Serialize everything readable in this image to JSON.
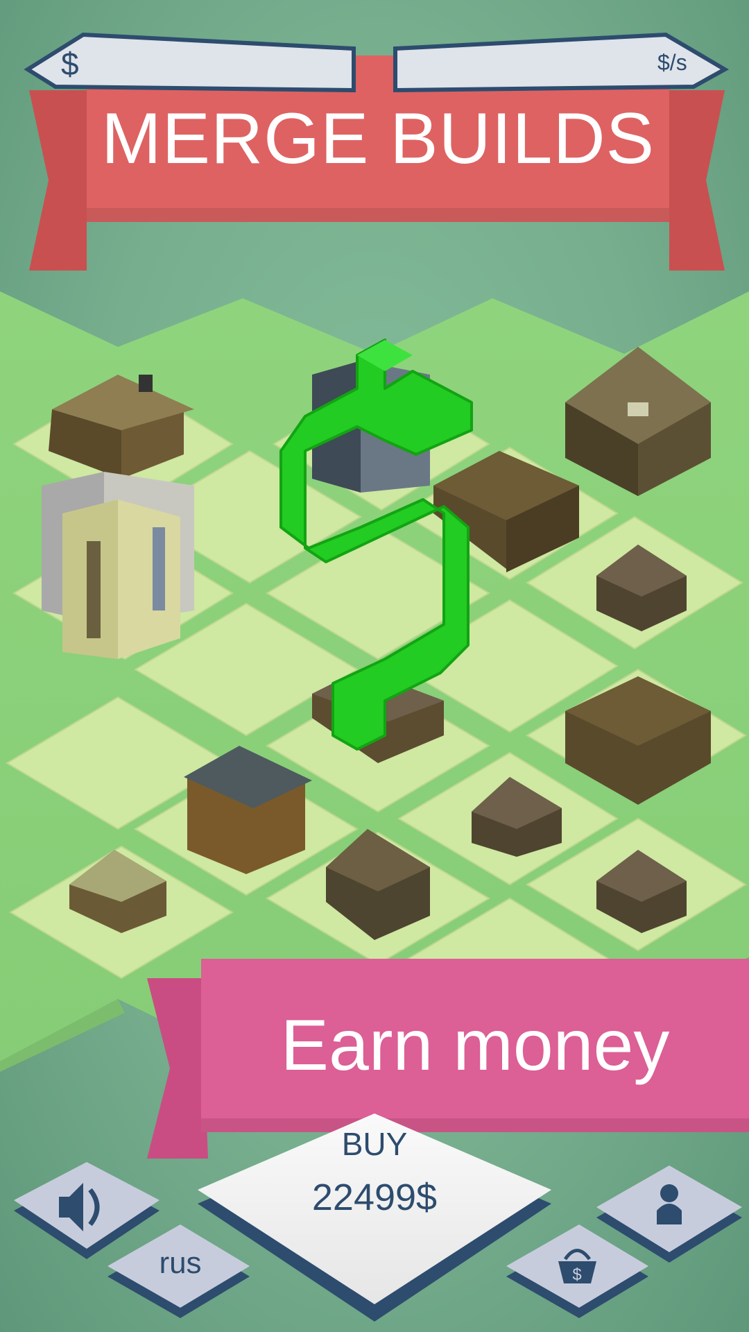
{
  "hud": {
    "money_symbol": "$",
    "income_symbol": "$/s"
  },
  "banners": {
    "top": "MERGE BUILDS",
    "bottom": "Earn money"
  },
  "buy_button": {
    "label": "BUY",
    "price": "22499$"
  },
  "controls": {
    "language": "rus",
    "sound_icon": "speaker-icon",
    "profile_icon": "person-icon",
    "shop_icon": "shopping-basket-icon"
  },
  "colors": {
    "banner_top": "#de6262",
    "banner_bottom": "#dc5f96",
    "dollar_sign": "#22cc22",
    "ui_text": "#2d4c6e"
  }
}
